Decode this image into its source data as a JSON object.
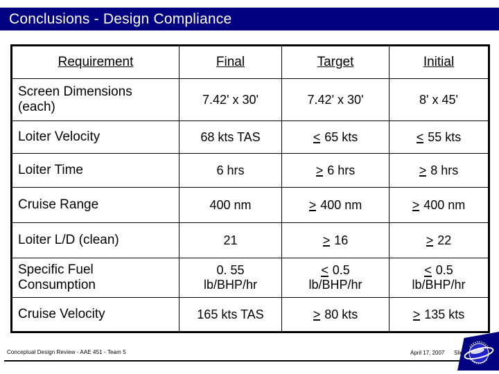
{
  "slide": {
    "title": "Conclusions - Design Compliance",
    "title_bar_color": "#000080",
    "background_color": "#FFFFFF",
    "text_color": "#000000"
  },
  "table": {
    "headers": {
      "requirement": "Requirement",
      "final": "Final",
      "target": "Target",
      "initial": "Initial"
    },
    "rows": [
      {
        "requirement_line1": "Screen Dimensions",
        "requirement_line2": "(each)",
        "final": "7.42' x 30'",
        "target": "7.42' x 30'",
        "initial": "8' x 45'"
      },
      {
        "requirement": "Loiter Velocity",
        "final": "68 kts TAS",
        "target_symbol": "<",
        "target": " 65 kts",
        "initial_symbol": "<",
        "initial": " 55 kts"
      },
      {
        "requirement": "Loiter Time",
        "final": "6 hrs",
        "target_symbol": ">",
        "target": " 6 hrs",
        "initial_symbol": ">",
        "initial": " 8 hrs"
      },
      {
        "requirement": "Cruise Range",
        "final": "400 nm",
        "target_symbol": ">",
        "target": " 400 nm",
        "initial_symbol": ">",
        "initial": " 400 nm"
      },
      {
        "requirement": "Loiter L/D (clean)",
        "final": "21",
        "target_symbol": ">",
        "target": " 16",
        "initial_symbol": ">",
        "initial": " 22"
      },
      {
        "requirement_line1": "Specific Fuel",
        "requirement_line2": "Consumption",
        "final_line1": "0. 55",
        "final_line2": "lb/BHP/hr",
        "target_symbol": "<",
        "target_line1": " 0.5",
        "target_line2": "lb/BHP/hr",
        "initial_symbol": "<",
        "initial_line1": " 0.5",
        "initial_line2": "lb/BHP/hr"
      },
      {
        "requirement": "Cruise Velocity",
        "final": "165 kts TAS",
        "target_symbol": ">",
        "target": " 80 kts",
        "initial_symbol": ">",
        "initial": " 135 kts"
      }
    ]
  },
  "footer": {
    "left": "Conceptual Design Review - AAE 451 - Team 5",
    "date": "April 17, 2007",
    "slide_number": "Slide 52"
  },
  "logo": {
    "name": "team-saucer-logo",
    "plate_color": "#000080",
    "emblem_color": "#2222CC"
  }
}
